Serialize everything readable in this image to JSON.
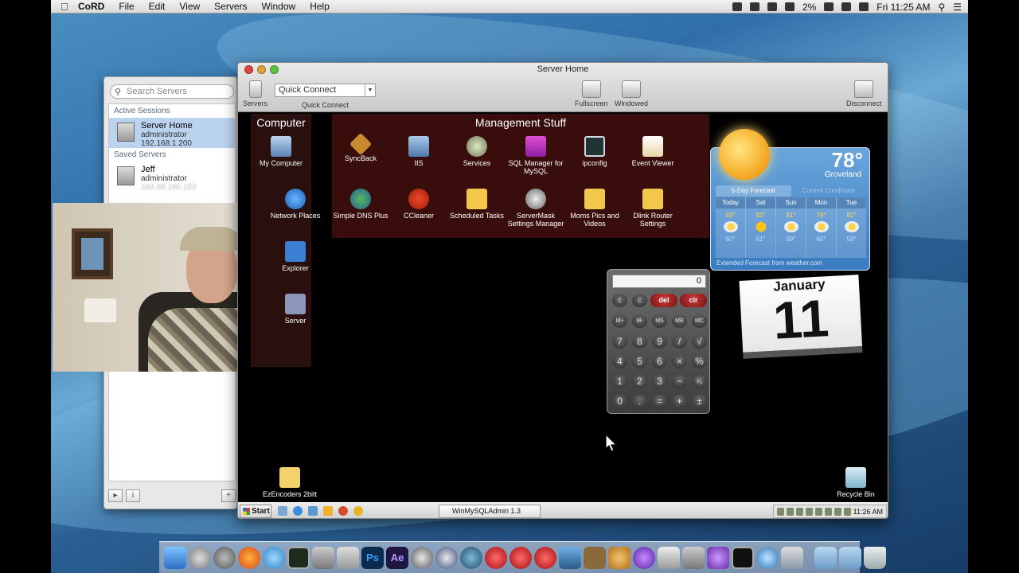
{
  "menubar": {
    "app_name": "CoRD",
    "items": [
      "File",
      "Edit",
      "View",
      "Servers",
      "Window",
      "Help"
    ],
    "battery": "2%",
    "clock": "Fri 11:25 AM"
  },
  "sidebar": {
    "search_placeholder": "Search Servers",
    "active_label": "Active Sessions",
    "active": {
      "name": "Server Home",
      "user": "administrator",
      "host": "192.168.1.200"
    },
    "saved_label": "Saved Servers",
    "saved": {
      "name": "Jeff",
      "user": "administrator",
      "host": "184.88.180.183"
    }
  },
  "window": {
    "title": "Server Home",
    "toolbar": {
      "servers": "Servers",
      "quick_connect_value": "Quick Connect",
      "quick_connect_label": "Quick Connect",
      "fullscreen": "Fullscreen",
      "windowed": "Windowed",
      "disconnect": "Disconnect"
    }
  },
  "remote_desktop": {
    "fence_computer": "Computer",
    "fence_management": "Management Stuff",
    "computer_icons": [
      "My Computer",
      "Network\nPlaces",
      "Explorer",
      "Server"
    ],
    "management_icons": [
      "SyncBack",
      "IIS",
      "Services",
      "SQL Manager for MySQL",
      "ipconfig",
      "Event Viewer",
      "Simple DNS Plus",
      "CCleaner",
      "Scheduled Tasks",
      "ServerMask Settings Manager",
      "Moms Pics and Videos",
      "Dlink Router Settings"
    ],
    "desktop_icons": {
      "bottom_left": "EzEncoders 2bitt",
      "recycle": "Recycle Bin"
    },
    "taskbar": {
      "start": "Start",
      "task": "WinMySQLAdmin 1.3",
      "clock": "11:26 AM"
    }
  },
  "weather": {
    "temp": "78°",
    "city": "Groveland",
    "tab_active": "5-Day Forecast",
    "tab_inactive": "Current Conditions",
    "days": [
      {
        "day": "Today",
        "hi": "83°",
        "lo": "60°"
      },
      {
        "day": "Sat",
        "hi": "83°",
        "lo": "61°"
      },
      {
        "day": "Sun",
        "hi": "81°",
        "lo": "59°"
      },
      {
        "day": "Mon",
        "hi": "79°",
        "lo": "60°"
      },
      {
        "day": "Tue",
        "hi": "81°",
        "lo": "59°"
      }
    ],
    "footer": "Extended Forecast from weather.com"
  },
  "calculator": {
    "display": "0",
    "keys": [
      [
        "c",
        "c",
        "del",
        "clr"
      ],
      [
        "M+",
        "M-",
        "MS",
        "MR",
        "MC"
      ],
      [
        "7",
        "8",
        "9",
        "/",
        "√"
      ],
      [
        "4",
        "5",
        "6",
        "×",
        "%"
      ],
      [
        "1",
        "2",
        "3",
        "−",
        "¹⁄ₓ"
      ],
      [
        "0",
        ".",
        "=",
        "+",
        "±"
      ]
    ]
  },
  "calendar": {
    "month": "January",
    "day": "11"
  }
}
